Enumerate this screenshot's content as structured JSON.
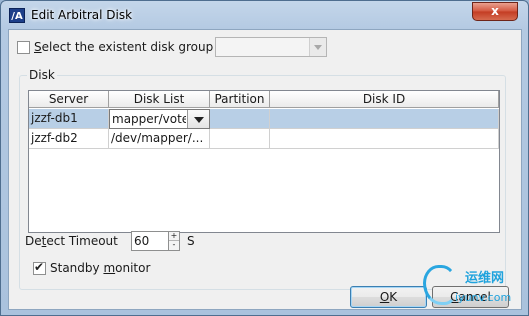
{
  "window": {
    "title": "Edit Arbitral Disk",
    "app_icon_text": "/A",
    "close_glyph": "x"
  },
  "disk_group_option": {
    "label_prefix": "",
    "label_mnemonic": "S",
    "label_rest": "elect the existent disk group",
    "checked": false,
    "combo_value": ""
  },
  "disk_section": {
    "legend": "Disk",
    "columns": [
      "Server",
      "Disk List",
      "Partition",
      "Disk ID"
    ],
    "rows": [
      {
        "server": "jzzf-db1",
        "disk_list": "mapper/vote",
        "partition": "",
        "disk_id": "",
        "selected": true,
        "editing": true
      },
      {
        "server": "jzzf-db2",
        "disk_list": "/dev/mapper/...",
        "partition": "",
        "disk_id": "",
        "selected": false,
        "editing": false
      }
    ]
  },
  "detect_timeout": {
    "label_pre": "De",
    "label_mnemonic": "t",
    "label_post": "ect Timeout",
    "value": "60",
    "unit": "S",
    "spin_up": "+",
    "spin_down": "-"
  },
  "standby_monitor": {
    "label_pre": "Standby ",
    "label_mnemonic": "m",
    "label_post": "onitor",
    "checked": true
  },
  "buttons": {
    "ok_mnemonic": "O",
    "ok_rest": "K",
    "cancel_mnemonic": "C",
    "cancel_rest": "ancel"
  },
  "watermark": {
    "cn_text": "运维网",
    "url_text": "iyunv.com"
  }
}
